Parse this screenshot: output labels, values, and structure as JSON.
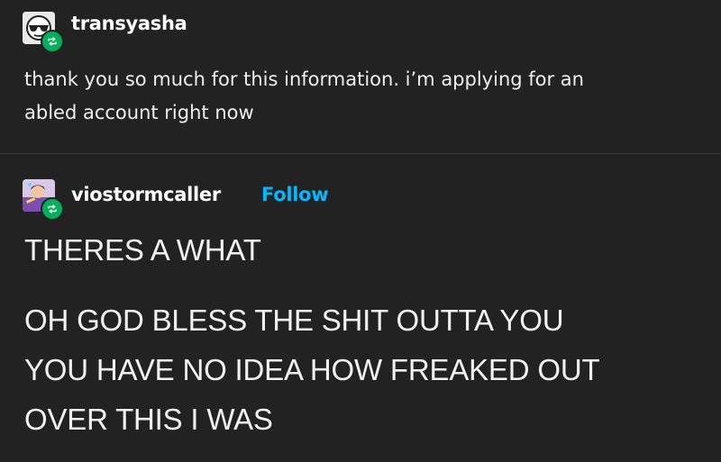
{
  "posts": [
    {
      "username": "transyasha",
      "avatar_icon": "sunglasses-face-icon",
      "badge_icon": "reblog-icon",
      "lines": [
        "thank you so much for this information. i’m applying for an",
        "abled account right now"
      ]
    },
    {
      "username": "viostormcaller",
      "follow_label": "Follow",
      "avatar_icon": "illustrated-avatar-icon",
      "badge_icon": "reblog-icon",
      "paragraphs": [
        "THERES A WHAT",
        "OH GOD BLESS THE SHIT OUTTA YOU",
        "YOU HAVE NO IDEA HOW FREAKED OUT",
        "OVER THIS I WAS"
      ]
    }
  ],
  "colors": {
    "background": "#222222",
    "text": "#f0f0f0",
    "follow": "#00b8ff",
    "reblog_badge": "#00b05b"
  }
}
